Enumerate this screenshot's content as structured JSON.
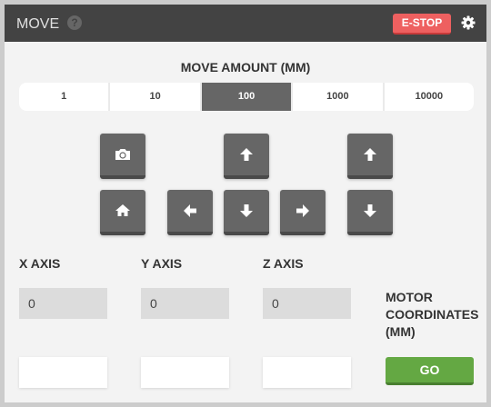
{
  "header": {
    "title": "MOVE",
    "help_icon": "question-circle-icon",
    "estop_label": "E-STOP",
    "settings_icon": "gear-icon"
  },
  "move_amount": {
    "label": "MOVE AMOUNT (MM)",
    "options": [
      "1",
      "10",
      "100",
      "1000",
      "10000"
    ],
    "selected": "100"
  },
  "jog": {
    "camera_icon": "camera-icon",
    "home_icon": "home-icon",
    "xy_up": "arrow-up-icon",
    "xy_down": "arrow-down-icon",
    "left": "arrow-left-icon",
    "right": "arrow-right-icon",
    "z_up": "arrow-up-icon",
    "z_down": "arrow-down-icon"
  },
  "axes": [
    {
      "label": "X AXIS",
      "value": "0",
      "input": ""
    },
    {
      "label": "Y AXIS",
      "value": "0",
      "input": ""
    },
    {
      "label": "Z AXIS",
      "value": "0",
      "input": ""
    }
  ],
  "motor_coordinates_label": "MOTOR COORDINATES (MM)",
  "go_label": "GO",
  "colors": {
    "header": "#434343",
    "estop": "#ee6060",
    "go": "#64a843",
    "selected": "#666666"
  }
}
